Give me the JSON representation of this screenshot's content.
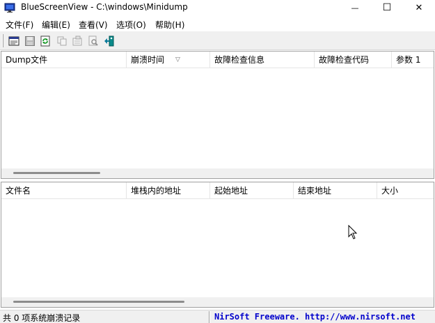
{
  "window": {
    "title": "BlueScreenView  -  C:\\windows\\Minidump",
    "minimize_glyph": "—",
    "maximize_glyph": "☐",
    "close_glyph": "✕"
  },
  "menu": {
    "items": [
      {
        "label": "文件(F)"
      },
      {
        "label": "编辑(E)"
      },
      {
        "label": "查看(V)"
      },
      {
        "label": "选项(O)"
      },
      {
        "label": "帮助(H)"
      }
    ]
  },
  "toolbar": {
    "buttons": [
      {
        "icon": "html-report-icon"
      },
      {
        "icon": "save-icon"
      },
      {
        "icon": "refresh-icon"
      },
      {
        "icon": "copy-icon"
      },
      {
        "icon": "properties-icon"
      },
      {
        "icon": "find-icon"
      },
      {
        "icon": "exit-icon"
      }
    ]
  },
  "top_list": {
    "columns": [
      {
        "label": "Dump文件"
      },
      {
        "label": "崩溃时间"
      },
      {
        "label": "故障检查信息"
      },
      {
        "label": "故障检查代码"
      },
      {
        "label": "参数 1"
      }
    ],
    "sort_glyph": "▽"
  },
  "bottom_list": {
    "columns": [
      {
        "label": "文件名"
      },
      {
        "label": "堆栈内的地址"
      },
      {
        "label": "起始地址"
      },
      {
        "label": "结束地址"
      },
      {
        "label": "大小"
      }
    ]
  },
  "status": {
    "left_text": "共 0 项系统崩溃记录",
    "right_text": "NirSoft Freeware.  http://www.nirsoft.net"
  },
  "colors": {
    "status_link": "#0000cc",
    "toolbar_bg": "#f0f0f0"
  }
}
